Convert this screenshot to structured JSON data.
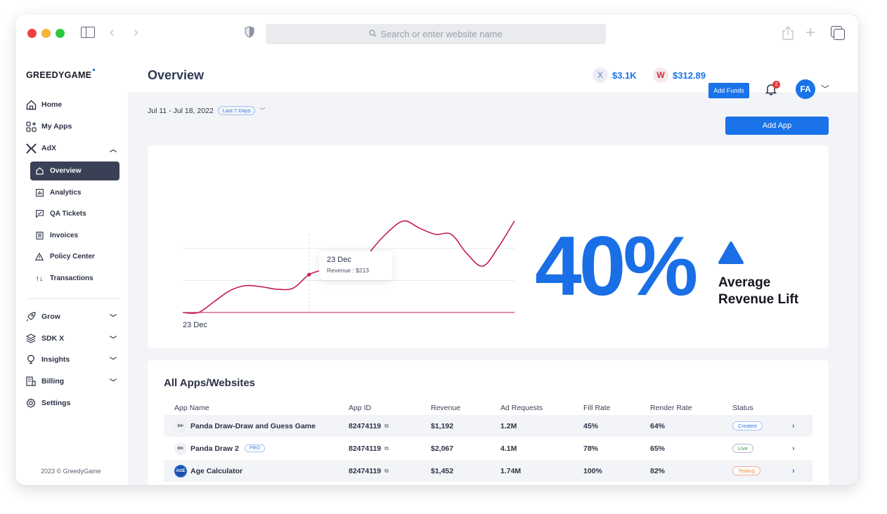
{
  "browser": {
    "search_placeholder": "Search or enter website name"
  },
  "sidebar": {
    "brand": "GREEDYGAME",
    "items": [
      {
        "label": "Home",
        "icon": "home-icon"
      },
      {
        "label": "My Apps",
        "icon": "apps-grid-icon"
      },
      {
        "label": "AdX",
        "icon": "adx-logo-icon",
        "expanded": true
      }
    ],
    "adx_subitems": [
      {
        "label": "Overview",
        "icon": "home-icon",
        "active": true
      },
      {
        "label": "Analytics",
        "icon": "bar-chart-icon"
      },
      {
        "label": "QA Tickets",
        "icon": "ticket-icon"
      },
      {
        "label": "Invoices",
        "icon": "receipt-icon"
      },
      {
        "label": "Policy Center",
        "icon": "warning-icon"
      },
      {
        "label": "Transactions",
        "icon": "arrows-updown-icon"
      }
    ],
    "groups": [
      {
        "label": "Grow",
        "icon": "rocket-icon"
      },
      {
        "label": "SDK X",
        "icon": "layers-icon"
      },
      {
        "label": "Insights",
        "icon": "lightbulb-icon"
      },
      {
        "label": "Billing",
        "icon": "billing-icon"
      },
      {
        "label": "Settings",
        "icon": "gear-icon"
      }
    ],
    "footer": "2023 © GreedyGame"
  },
  "header": {
    "title": "Overview",
    "adx_balance": "$3.1K",
    "adx_badge": "X",
    "wallet_balance": "$312.89",
    "wallet_badge": "W",
    "add_funds_label": "Add Funds",
    "notification_count": "2",
    "avatar_initials": "FA"
  },
  "filters": {
    "date_range": "Jul 11 - Jul 18, 2022",
    "preset": "Last 7 Days",
    "add_app_label": "Add App"
  },
  "chart_data": {
    "type": "line",
    "title": "",
    "series": [
      {
        "name": "Revenue",
        "color": "#c2185b",
        "values": [
          0,
          0,
          45,
          90,
          110,
          105,
          95,
          100,
          155,
          175,
          185,
          170,
          260,
          330,
          375,
          345,
          320,
          320,
          240,
          190,
          270,
          375
        ]
      }
    ],
    "x_label_shown": "23 Dec",
    "ylim": [
      0,
      420
    ],
    "gridlines": 3,
    "grid": true,
    "tooltip": {
      "date": "23 Dec",
      "text": "Revenue : $213"
    }
  },
  "highlight": {
    "value": "40%",
    "label_line1": "Average",
    "label_line2": "Revenue Lift",
    "trend": "up"
  },
  "apps_table": {
    "title": "All Apps/Websites",
    "columns": [
      "App Name",
      "App ID",
      "Revenue",
      "Ad Requests",
      "Fill Rate",
      "Render Rate",
      "Status"
    ],
    "rows": [
      {
        "name": "Panda Draw-Draw and Guess Game",
        "icon": "panda-app-icon",
        "tag": "",
        "app_id": "82474119",
        "revenue": "$1,192",
        "ad_requests": "1.2M",
        "fill_rate": "45%",
        "render_rate": "64%",
        "status": "Created"
      },
      {
        "name": "Panda Draw 2",
        "icon": "panda-app-icon",
        "tag": "PRO",
        "app_id": "82474119",
        "revenue": "$2,067",
        "ad_requests": "4.1M",
        "fill_rate": "78%",
        "render_rate": "65%",
        "status": "Live"
      },
      {
        "name": "Age Calculator",
        "icon": "age-app-icon",
        "tag": "",
        "app_id": "82474119",
        "revenue": "$1,452",
        "ad_requests": "1.74M",
        "fill_rate": "100%",
        "render_rate": "82%",
        "status": "Testing"
      }
    ],
    "age_icon_text": "AGE"
  },
  "colors": {
    "accent": "#1a73e8",
    "chart_line": "#c2185b",
    "sidebar_active": "#3a4156"
  }
}
